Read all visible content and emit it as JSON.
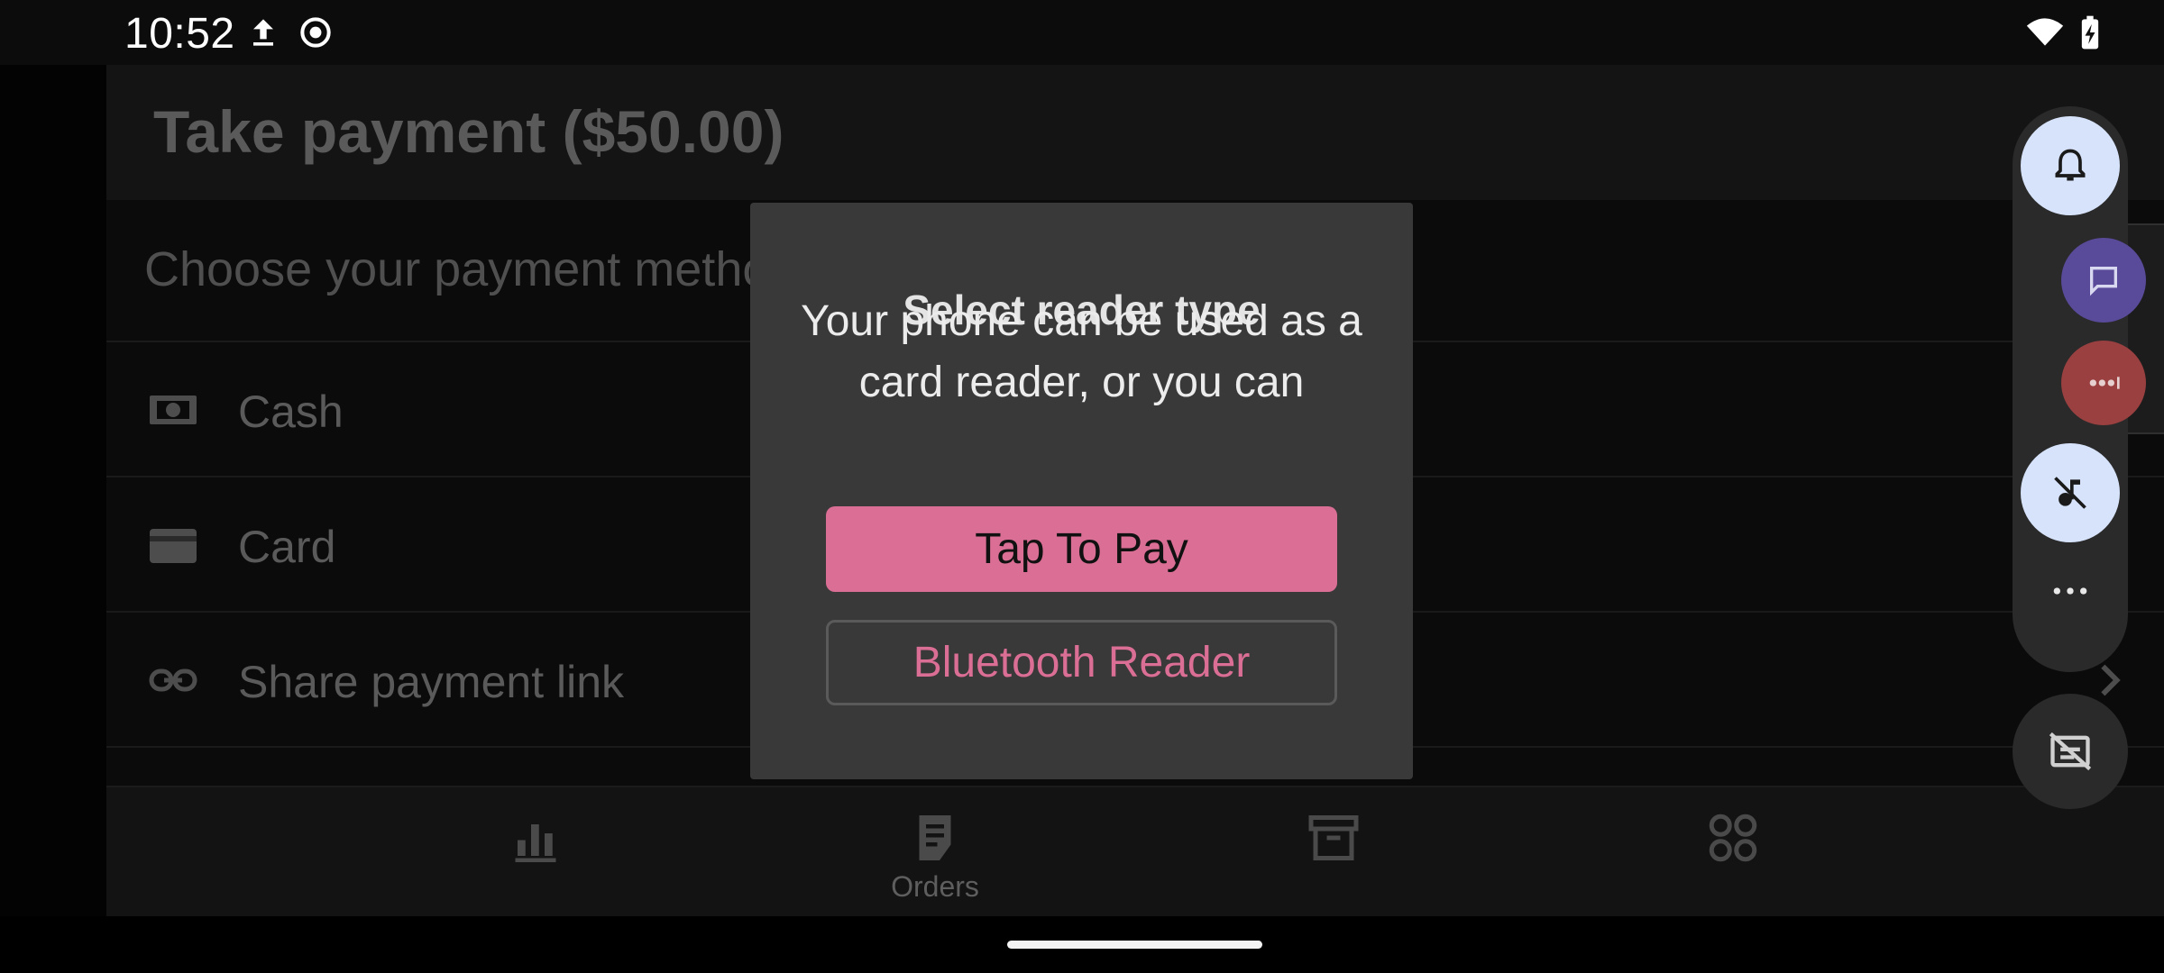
{
  "status_bar": {
    "time": "10:52"
  },
  "app": {
    "title": "Take payment ($50.00)",
    "section_heading": "Choose your payment method",
    "payment_methods": [
      {
        "label": "Cash",
        "icon": "cash-icon"
      },
      {
        "label": "Card",
        "icon": "card-icon"
      },
      {
        "label": "Share payment link",
        "icon": "link-icon"
      }
    ]
  },
  "bottom_nav": {
    "items": [
      {
        "label": "",
        "icon": "analytics-icon"
      },
      {
        "label": "Orders",
        "icon": "orders-icon"
      },
      {
        "label": "",
        "icon": "products-icon"
      },
      {
        "label": "",
        "icon": "menu-grid-icon"
      }
    ]
  },
  "dialog": {
    "title": "Select reader type",
    "message": "Your phone can be used as a card reader, or you can connect to an external reader via bluetooth.",
    "primary_button": "Tap To Pay",
    "secondary_button": "Bluetooth Reader"
  },
  "floating_panel": {
    "buttons": [
      "bell-icon",
      "chat-bubble-icon",
      "more-bubble-icon",
      "mute-icon",
      "more-horizontal-icon",
      "hide-captions-icon"
    ]
  },
  "colors": {
    "accent": "#db6e94",
    "dialog_bg": "#393939",
    "panel_bg": "#2a2a2a",
    "circle_light": "#d6e3fb"
  }
}
